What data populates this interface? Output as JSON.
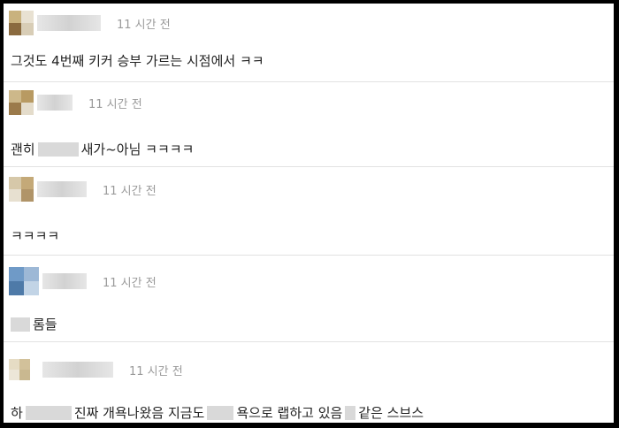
{
  "comments": [
    {
      "time": "11 시간 전",
      "text": "그것도 4번째 키커 승부 가르는 시점에서 ㅋㅋ",
      "avatar_colors": [
        "#c9b27e",
        "#e8e1d2",
        "#8a6a3f",
        "#d8cdb6"
      ]
    },
    {
      "time": "11 시간 전",
      "text_a": "괜히",
      "text_b": "새가~아님 ㅋㅋㅋㅋ",
      "avatar_colors": [
        "#cdb88a",
        "#b89a62",
        "#9b7a4a",
        "#e4dccb"
      ]
    },
    {
      "time": "11 시간 전",
      "text": "ㅋㅋㅋㅋ",
      "avatar_colors": [
        "#d6c8a9",
        "#c4a978",
        "#e7e0d0",
        "#b09468"
      ]
    },
    {
      "time": "11 시간 전",
      "text": "롬들",
      "avatar_colors": [
        "#6f9ac7",
        "#9db8d6",
        "#4e7aa8",
        "#c2d4e6"
      ]
    },
    {
      "time": "11 시간 전",
      "text_a": "하",
      "text_b": "진짜 개욕나왔음 지금도",
      "text_c": "욕으로 랩하고 있음",
      "text_d": "같은 스브스",
      "avatar_colors": [
        "#e6dcc4",
        "#d2c19a",
        "#ece6d8",
        "#c9b890"
      ]
    }
  ]
}
